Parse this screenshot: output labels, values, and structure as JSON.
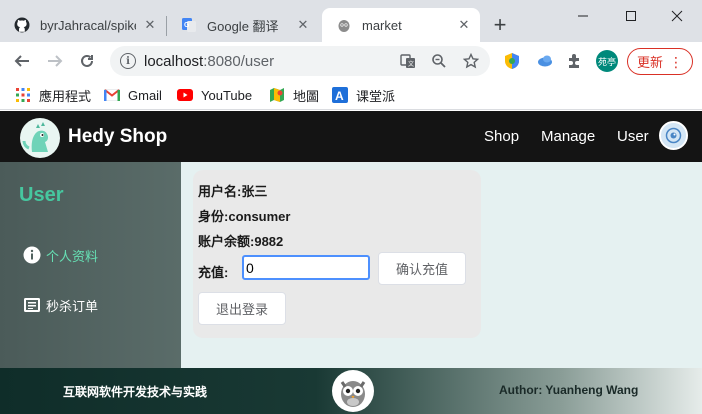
{
  "browser": {
    "tabs": [
      {
        "title": "byrJahracal/spike",
        "icon": "github-icon"
      },
      {
        "title": "Google 翻译",
        "icon": "google-translate-icon"
      },
      {
        "title": "market",
        "icon": "market-favicon",
        "active": true
      }
    ],
    "url_host": "localhost",
    "url_rest": ":8080/user",
    "profile_label": "苑亭",
    "update_label": "更新",
    "bookmarks": [
      {
        "label": "應用程式",
        "icon": "apps-grid-icon"
      },
      {
        "label": "Gmail",
        "icon": "gmail-icon"
      },
      {
        "label": "YouTube",
        "icon": "youtube-icon"
      },
      {
        "label": "地圖",
        "icon": "maps-icon"
      },
      {
        "label": "课堂派",
        "icon": "ketangpai-icon"
      }
    ]
  },
  "site": {
    "brand": "Hedy Shop",
    "nav": {
      "shop": "Shop",
      "manage": "Manage",
      "user": "User"
    }
  },
  "sidebar": {
    "title": "User",
    "items": [
      {
        "label": "个人资料",
        "icon": "info-icon",
        "active": true
      },
      {
        "label": "秒杀订单",
        "icon": "order-list-icon",
        "active": false
      }
    ]
  },
  "profile": {
    "username_label": "用户名:",
    "username": "张三",
    "role_label": "身份:",
    "role": "consumer",
    "balance_label": "账户余额:",
    "balance": "9882",
    "charge_label": "充值:",
    "charge_value": "0",
    "confirm_button": "确认充值",
    "logout_button": "退出登录"
  },
  "footer": {
    "left": "互联网软件开发技术与实践",
    "right": "Author: Yuanheng Wang"
  },
  "colors": {
    "nav_bg": "#141414",
    "sidebar_bg": "#52625f",
    "accent": "#46c79f",
    "content_bg": "#e5f1f1"
  }
}
